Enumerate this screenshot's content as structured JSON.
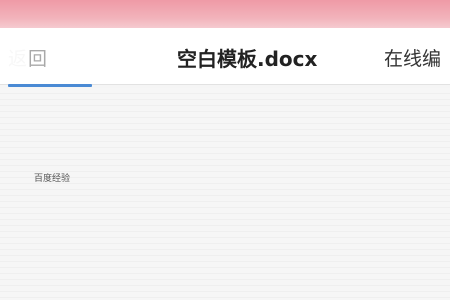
{
  "status_bar": {
    "color": "#f2b3bb"
  },
  "nav": {
    "back_label": "返回",
    "back_visible_label": "回",
    "title": "空白模板.docx",
    "online_edit_label": "在线编",
    "accent_color": "#4a8ad4"
  },
  "document": {
    "body_text": "百度经验"
  },
  "icons": {
    "back": "back-arrow-icon"
  }
}
